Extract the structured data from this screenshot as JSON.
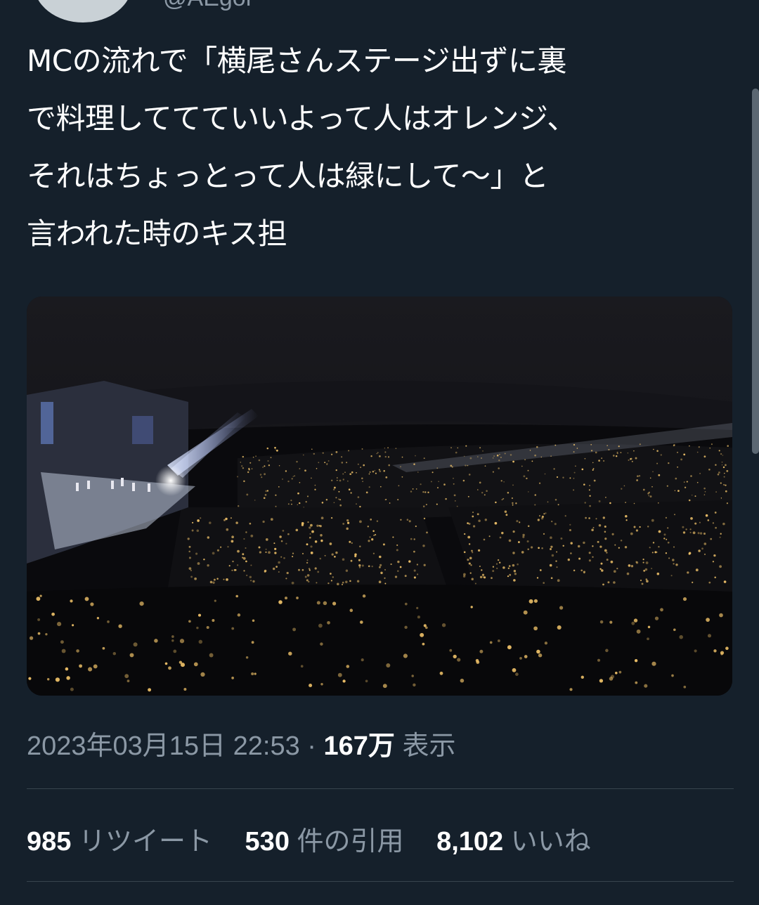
{
  "author": {
    "handle": "@AEgor"
  },
  "tweet": {
    "text": "MCの流れで「横尾さんステージ出ずに裏\nで料理しててていいよって人はオレンジ、\nそれはちょっとって人は緑にして〜」と\n言われた時のキス担"
  },
  "meta": {
    "datetime": "2023年03月15日 22:53",
    "separator": "·",
    "views_count": "167万",
    "views_label": "表示"
  },
  "stats": {
    "retweets": {
      "count": "985",
      "label": "リツイート"
    },
    "quotes": {
      "count": "530",
      "label": "件の引用"
    },
    "likes": {
      "count": "8,102",
      "label": "いいね"
    }
  },
  "colors": {
    "background": "#15202b",
    "secondary_text": "#8b98a5",
    "divider": "#38444d",
    "penlight": "#f2c46a"
  }
}
